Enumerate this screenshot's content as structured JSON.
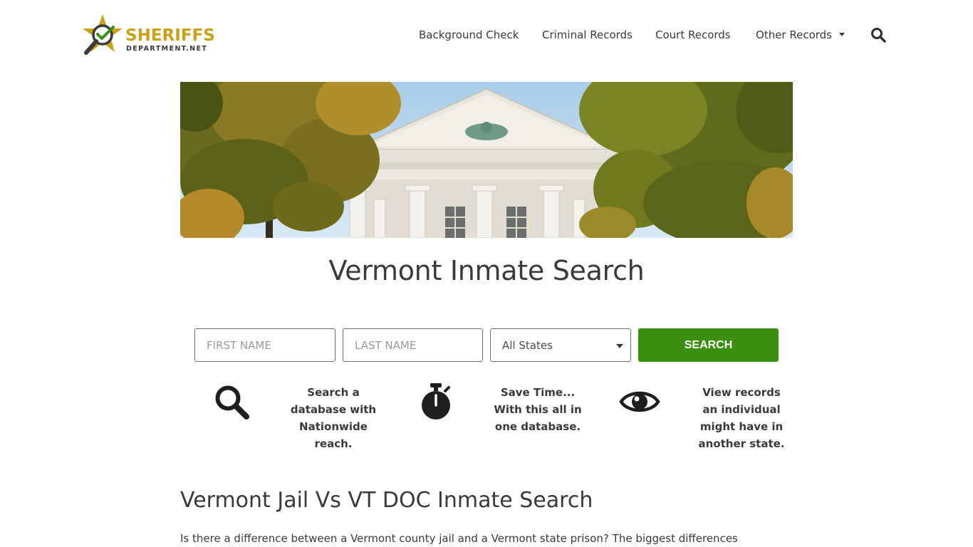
{
  "header": {
    "logo": {
      "line1": "SHERIFFS",
      "line2": "DEPARTMENT.NET",
      "icon": "star-magnifier-check-logo",
      "colors": {
        "gold": "#c9a21a",
        "dark": "#3a3a3a",
        "green": "#3a8f0f"
      }
    },
    "nav": [
      {
        "label": "Background Check"
      },
      {
        "label": "Criminal Records"
      },
      {
        "label": "Court Records"
      },
      {
        "label": "Other Records",
        "icon": "caret-down-icon"
      }
    ],
    "search_icon": "search-icon"
  },
  "hero": {
    "image": "courthouse-with-autumn-trees"
  },
  "page_title": "Vermont Inmate Search",
  "search_form": {
    "first_name_placeholder": "FIRST NAME",
    "last_name_placeholder": "LAST NAME",
    "state_selected": "All States",
    "search_label": "SEARCH",
    "button_color": "#3a8f0f"
  },
  "features": [
    {
      "icon": "magnifier-icon",
      "lines": [
        "Search a",
        "database with",
        "Nationwide",
        "reach."
      ]
    },
    {
      "icon": "stopwatch-icon",
      "lines": [
        "Save Time...",
        "With this all in",
        "one database."
      ]
    },
    {
      "icon": "eye-icon",
      "lines": [
        "View records",
        "an individual",
        "might have in",
        "another state."
      ]
    }
  ],
  "section": {
    "title": "Vermont Jail Vs VT DOC Inmate Search",
    "paragraph": "Is there a difference between a Vermont county jail and a Vermont state prison? The biggest differences"
  }
}
